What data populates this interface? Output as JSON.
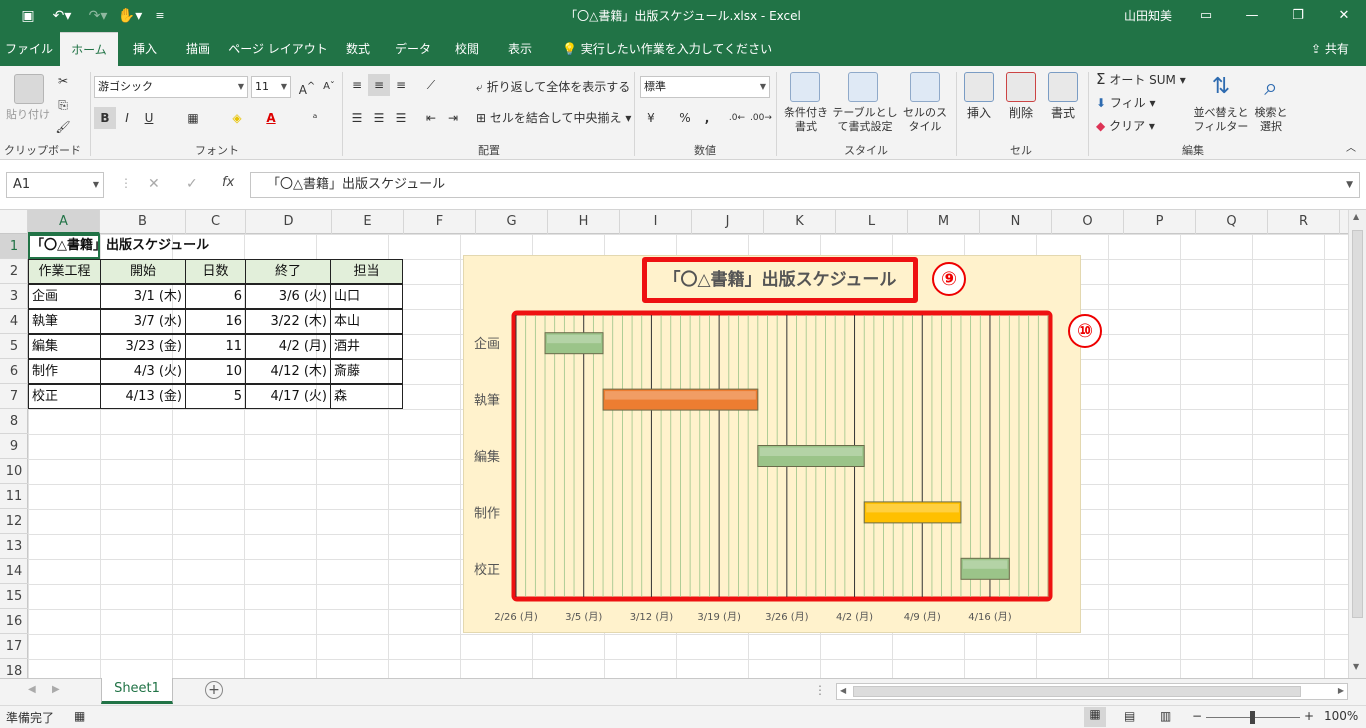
{
  "window": {
    "title": "「〇△書籍」出版スケジュール.xlsx  -  Excel",
    "user": "山田知美"
  },
  "tabs": [
    {
      "label": "ファイル",
      "active": false
    },
    {
      "label": "ホーム",
      "active": true
    },
    {
      "label": "挿入",
      "active": false
    },
    {
      "label": "描画",
      "active": false
    },
    {
      "label": "ページ レイアウト",
      "active": false
    },
    {
      "label": "数式",
      "active": false
    },
    {
      "label": "データ",
      "active": false
    },
    {
      "label": "校閲",
      "active": false
    },
    {
      "label": "表示",
      "active": false
    }
  ],
  "tell_me": "実行したい作業を入力してください",
  "share": "共有",
  "ribbon": {
    "clipboard": {
      "paste": "貼り付け",
      "label": "クリップボード"
    },
    "font": {
      "name": "游ゴシック",
      "size": "11",
      "label": "フォント",
      "bold": "B",
      "italic": "I",
      "underline": "U"
    },
    "alignment": {
      "wrap": "折り返して全体を表示する",
      "merge": "セルを結合して中央揃え",
      "label": "配置"
    },
    "number": {
      "format": "標準",
      "label": "数値",
      "percent": "%",
      "comma": ","
    },
    "styles": {
      "cond": "条件付き書式",
      "table": "テーブルとして書式設定",
      "cell": "セルのスタイル",
      "label": "スタイル"
    },
    "cells": {
      "insert": "挿入",
      "delete": "削除",
      "format": "書式",
      "label": "セル"
    },
    "editing": {
      "autosum": "オート SUM",
      "fill": "フィル",
      "clear": "クリア",
      "sort": "並べ替えとフィルター",
      "find": "検索と選択",
      "label": "編集"
    }
  },
  "formula_bar": {
    "name_box": "A1",
    "fx": "fx",
    "content": "「〇△書籍」出版スケジュール"
  },
  "columns": [
    "A",
    "B",
    "C",
    "D",
    "E",
    "F",
    "G",
    "H",
    "I",
    "J",
    "K",
    "L",
    "M",
    "N",
    "O",
    "P",
    "Q",
    "R"
  ],
  "rows": [
    "1",
    "2",
    "3",
    "4",
    "5",
    "6",
    "7",
    "8",
    "9",
    "10",
    "11",
    "12",
    "13",
    "14",
    "15",
    "16",
    "17",
    "18"
  ],
  "sheet": {
    "title": "「〇△書籍」出版スケジュール",
    "headers": [
      "作業工程",
      "開始",
      "日数",
      "終了",
      "担当"
    ],
    "data": [
      [
        "企画",
        "3/1 (木)",
        "6",
        "3/6 (火)",
        "山口"
      ],
      [
        "執筆",
        "3/7 (水)",
        "16",
        "3/22 (木)",
        "本山"
      ],
      [
        "編集",
        "3/23 (金)",
        "11",
        "4/2 (月)",
        "酒井"
      ],
      [
        "制作",
        "4/3 (火)",
        "10",
        "4/12 (木)",
        "斎藤"
      ],
      [
        "校正",
        "4/13 (金)",
        "5",
        "4/17 (火)",
        "森"
      ]
    ]
  },
  "chart_data": {
    "type": "bar",
    "orientation": "horizontal",
    "title": "「〇△書籍」出版スケジュール",
    "categories": [
      "企画",
      "執筆",
      "編集",
      "制作",
      "校正"
    ],
    "start_dates": [
      "3/1",
      "3/7",
      "3/23",
      "4/3",
      "4/13"
    ],
    "durations": [
      6,
      16,
      11,
      10,
      5
    ],
    "bar_colors": [
      "#9bc489",
      "#ed7d31",
      "#9bc489",
      "#ffc000",
      "#9bc489"
    ],
    "x_tick_labels": [
      "2/26 (月)",
      "3/5 (月)",
      "3/12 (月)",
      "3/19 (月)",
      "3/26 (月)",
      "4/2 (月)",
      "4/9 (月)",
      "4/16 (月)"
    ],
    "xlim": [
      "2/26",
      "4/22"
    ],
    "grid": "vertical",
    "background": "#fff2cc"
  },
  "callouts": [
    "⑨",
    "⑩"
  ],
  "sheet_tabs": [
    "Sheet1"
  ],
  "status": {
    "ready": "準備完了",
    "zoom": "100%"
  }
}
